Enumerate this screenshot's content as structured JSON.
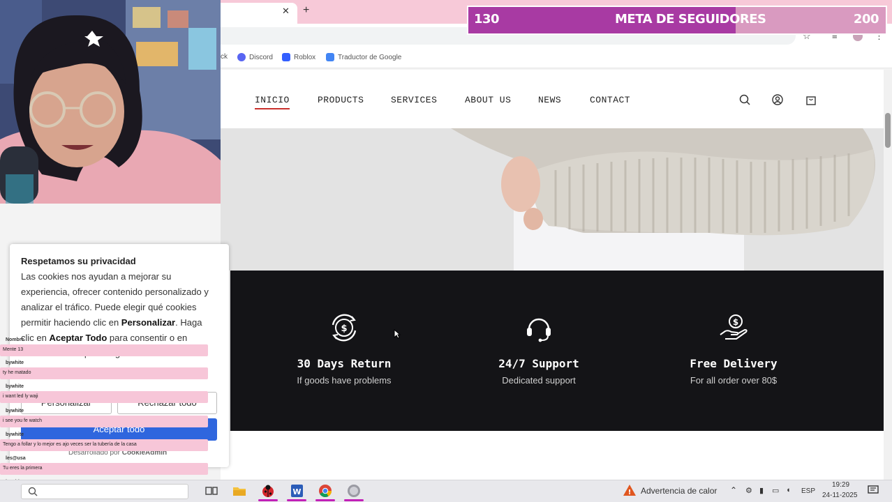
{
  "browser": {
    "new_tab_symbol": "+",
    "close_tab_symbol": "✕",
    "bookmarks": [
      {
        "label": "ck",
        "icon": "bookmark-icon"
      },
      {
        "label": "Discord",
        "icon": "discord-icon"
      },
      {
        "label": "Roblox",
        "icon": "roblox-icon"
      },
      {
        "label": "Traductor de Google",
        "icon": "google-translate-icon"
      }
    ]
  },
  "goal": {
    "current": "130",
    "title": "META DE SEGUIDORES",
    "target": "200",
    "progress": 0.64,
    "fill_color": "#a83aa3",
    "track_color": "#d99ac0"
  },
  "site": {
    "nav": [
      "INICIO",
      "PRODUCTS",
      "SERVICES",
      "ABOUT US",
      "NEWS",
      "CONTACT"
    ],
    "active_nav": "INICIO",
    "accent": "#c9302c",
    "features": [
      {
        "title": "30 Days Return",
        "subtitle": "If goods have problems",
        "icon": "money-return-icon"
      },
      {
        "title": "24/7 Support",
        "subtitle": "Dedicated support",
        "icon": "headset-icon"
      },
      {
        "title": "Free Delivery",
        "subtitle": "For all order over 80$",
        "icon": "hand-coin-icon"
      }
    ]
  },
  "cookie": {
    "title": "Respetamos su privacidad",
    "body_1": "Las cookies nos ayudan a mejorar su experiencia, ofrecer contenido personalizado y analizar el tráfico. Puede elegir qué cookies permitir haciendo clic en ",
    "personalizar_bold": "Personalizar",
    "body_2": ". Haga clic en ",
    "aceptar_bold": "Aceptar Todo",
    "body_3": " para consentir o en",
    "body_4": "Rechazar Todo para negar las cookies no",
    "btn_customize": "Personalizar",
    "btn_reject": "Rechazar todo",
    "btn_accept": "Aceptar todo",
    "footer": "Desarrollado por",
    "footer_brand": "CookieAdmin",
    "primary_color": "#2f66de"
  },
  "chat": [
    {
      "name": "Nombre",
      "msg": "Mente 13"
    },
    {
      "name": "bywhite",
      "msg": "ty he matado"
    },
    {
      "name": "bywhite",
      "msg": "i want led ly waji"
    },
    {
      "name": "bywhite",
      "msg": "i see you fe watch"
    },
    {
      "name": "bywhite",
      "msg": "Tengo a follar y lo mejor es ajo veces ser la tubería de la casa"
    },
    {
      "name": "les@usa",
      "msg": "Tu eres la primera"
    },
    {
      "name": "bywhite",
      "msg": "ty ahy fuerte gelo"
    }
  ],
  "taskbar": {
    "apps": [
      "task-view-icon",
      "file-explorer-icon",
      "ladybug-icon",
      "word-icon",
      "chrome-icon",
      "obs-icon"
    ],
    "weather_alert": "Advertencia de calor",
    "lang": "ESP",
    "time": "19:29",
    "date": "24-11-2025"
  }
}
